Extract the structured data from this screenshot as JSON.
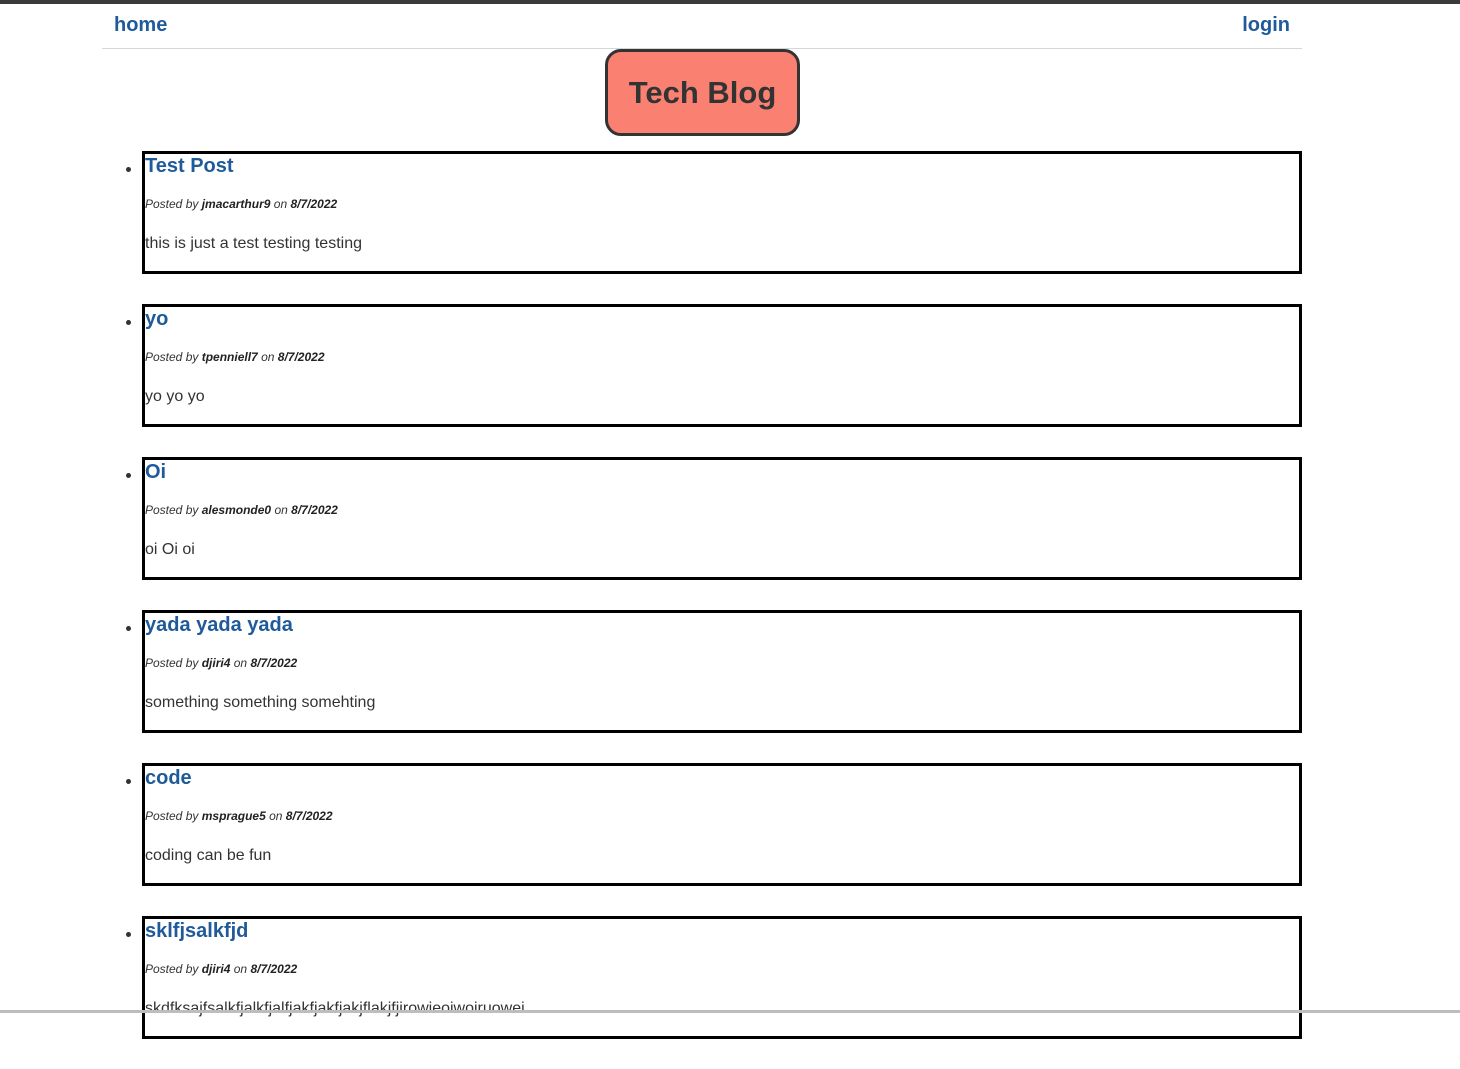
{
  "nav": {
    "home_label": "home",
    "login_label": "login"
  },
  "site_title": "Tech Blog",
  "colors": {
    "title_bg": "#fa8072",
    "link": "#1f5a9a"
  },
  "posts": [
    {
      "title": "Test Post",
      "prefix": "Posted by",
      "author": "jmacarthur9",
      "on": "on",
      "date": "8/7/2022",
      "body": "this is just a test testing testing"
    },
    {
      "title": "yo",
      "prefix": "Posted by",
      "author": "tpenniell7",
      "on": "on",
      "date": "8/7/2022",
      "body": "yo yo yo"
    },
    {
      "title": "Oi",
      "prefix": "Posted by",
      "author": "alesmonde0",
      "on": "on",
      "date": "8/7/2022",
      "body": "oi Oi oi"
    },
    {
      "title": "yada yada yada",
      "prefix": "Posted by",
      "author": "djiri4",
      "on": "on",
      "date": "8/7/2022",
      "body": "something something somehting"
    },
    {
      "title": "code",
      "prefix": "Posted by",
      "author": "msprague5",
      "on": "on",
      "date": "8/7/2022",
      "body": "coding can be fun"
    },
    {
      "title": "sklfjsalkfjd",
      "prefix": "Posted by",
      "author": "djiri4",
      "on": "on",
      "date": "8/7/2022",
      "body": "skdfksajfsalkfjalkfjalfjakfjakfjakjflakjfjirowieoiwoiruowei"
    }
  ]
}
